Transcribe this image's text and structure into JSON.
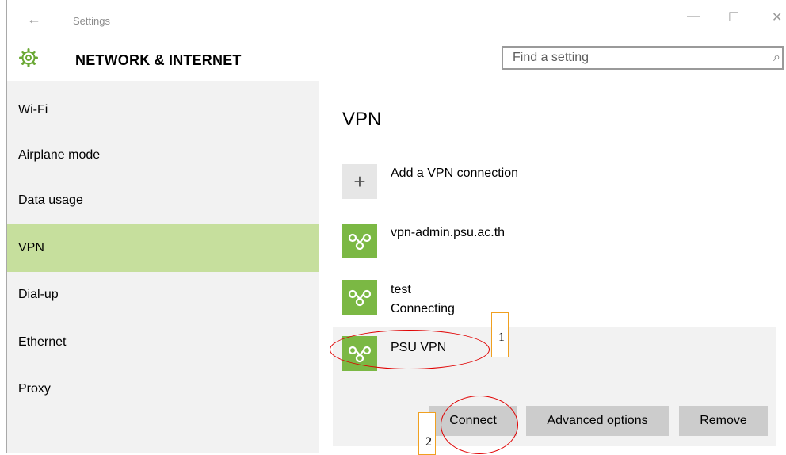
{
  "window": {
    "title": "Settings",
    "controls": {
      "back": "←",
      "minimize": "—",
      "maximize": "☐",
      "close": "✕"
    }
  },
  "header": {
    "icon": "gear-icon",
    "title": "NETWORK & INTERNET",
    "search_placeholder": "Find a setting",
    "search_icon": "⌕"
  },
  "sidebar": {
    "items": [
      {
        "label": "Wi-Fi"
      },
      {
        "label": "Airplane mode"
      },
      {
        "label": "Data usage"
      },
      {
        "label": "VPN",
        "active": true
      },
      {
        "label": "Dial-up"
      },
      {
        "label": "Ethernet"
      },
      {
        "label": "Proxy"
      }
    ]
  },
  "content": {
    "heading": "VPN",
    "add_label": "Add a VPN connection",
    "add_icon": "+",
    "connections": [
      {
        "name": "vpn-admin.psu.ac.th",
        "status": ""
      },
      {
        "name": "test",
        "status": "Connecting"
      },
      {
        "name": "PSU VPN",
        "status": ""
      }
    ],
    "buttons": {
      "connect": "Connect",
      "advanced": "Advanced options",
      "remove": "Remove"
    }
  },
  "annotations": {
    "one": "1",
    "two": "2"
  },
  "colors": {
    "accent": "#c6df9d",
    "vpn_tile": "#7bb844",
    "annotation_red": "#e00000",
    "annotation_orange": "#f0a020"
  }
}
